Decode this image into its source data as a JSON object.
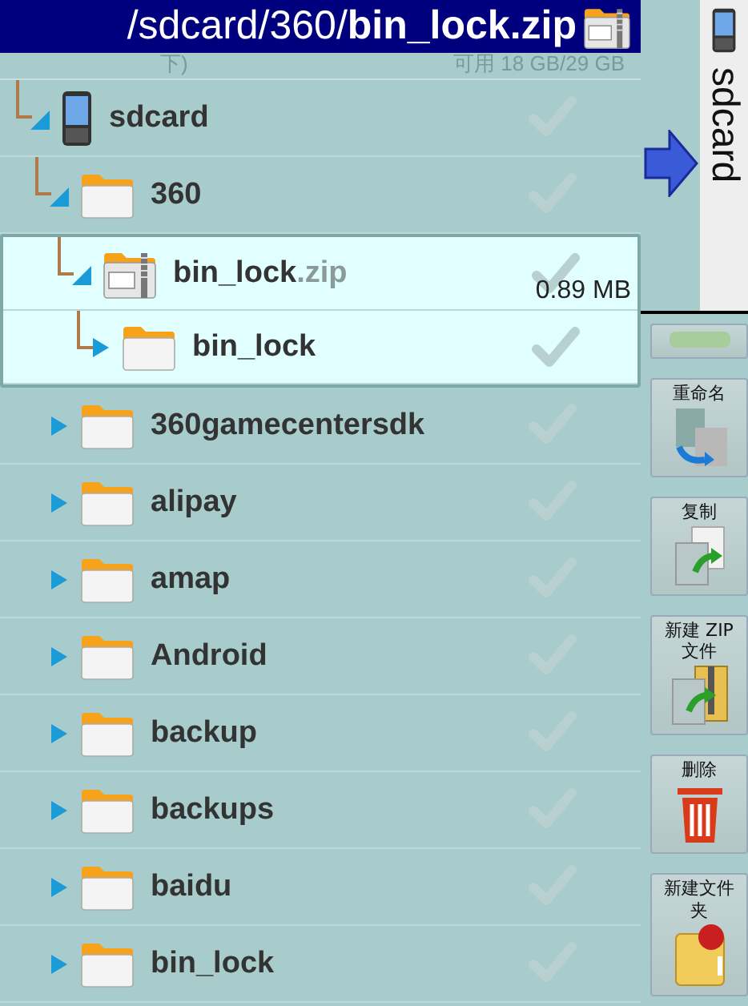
{
  "title_bar": {
    "path": "/sdcard/360/**bin_lock.zip**"
  },
  "storage_row": {
    "name": "下)",
    "info": "可用 18 GB/29 GB"
  },
  "tree": [
    {
      "name": "sdcard",
      "kind": "device",
      "expanded": true,
      "linked": true,
      "selected": false,
      "checked": false,
      "children": [
        {
          "name": "360",
          "kind": "folder",
          "expanded": true,
          "linked": true,
          "selected": false,
          "checked": false,
          "children": [
            {
              "name": "bin_lock",
              "ext": ".zip",
              "size": "0.89 MB",
              "kind": "zip",
              "expanded": true,
              "linked": true,
              "selected": true,
              "checked": false,
              "children": [
                {
                  "name": "bin_lock",
                  "kind": "folder",
                  "expanded": false,
                  "linked": true,
                  "selected": false,
                  "checked": false
                }
              ]
            }
          ]
        },
        {
          "name": "360gamecentersdk",
          "kind": "folder",
          "expanded": false,
          "linked": false,
          "selected": false,
          "checked": false
        },
        {
          "name": "alipay",
          "kind": "folder",
          "expanded": false,
          "linked": false,
          "selected": false,
          "checked": false
        },
        {
          "name": "amap",
          "kind": "folder",
          "expanded": false,
          "linked": false,
          "selected": false,
          "checked": false
        },
        {
          "name": "Android",
          "kind": "folder",
          "expanded": false,
          "linked": false,
          "selected": false,
          "checked": false
        },
        {
          "name": "backup",
          "kind": "folder",
          "expanded": false,
          "linked": false,
          "selected": false,
          "checked": false
        },
        {
          "name": "backups",
          "kind": "folder",
          "expanded": false,
          "linked": false,
          "selected": false,
          "checked": false
        },
        {
          "name": "baidu",
          "kind": "folder",
          "expanded": false,
          "linked": false,
          "selected": false,
          "checked": false
        },
        {
          "name": "bin_lock",
          "kind": "folder",
          "expanded": false,
          "linked": false,
          "selected": false,
          "checked": false
        }
      ]
    }
  ],
  "side_tab": {
    "label": "sdcard"
  },
  "toolbar": [
    {
      "kind": "blank"
    },
    {
      "kind": "rename",
      "label": "重命名"
    },
    {
      "kind": "copy",
      "label": "复制"
    },
    {
      "kind": "zip",
      "label": "新建 ZIP 文件"
    },
    {
      "kind": "delete",
      "label": "删除"
    },
    {
      "kind": "new-folder",
      "label": "新建文件夹"
    }
  ]
}
